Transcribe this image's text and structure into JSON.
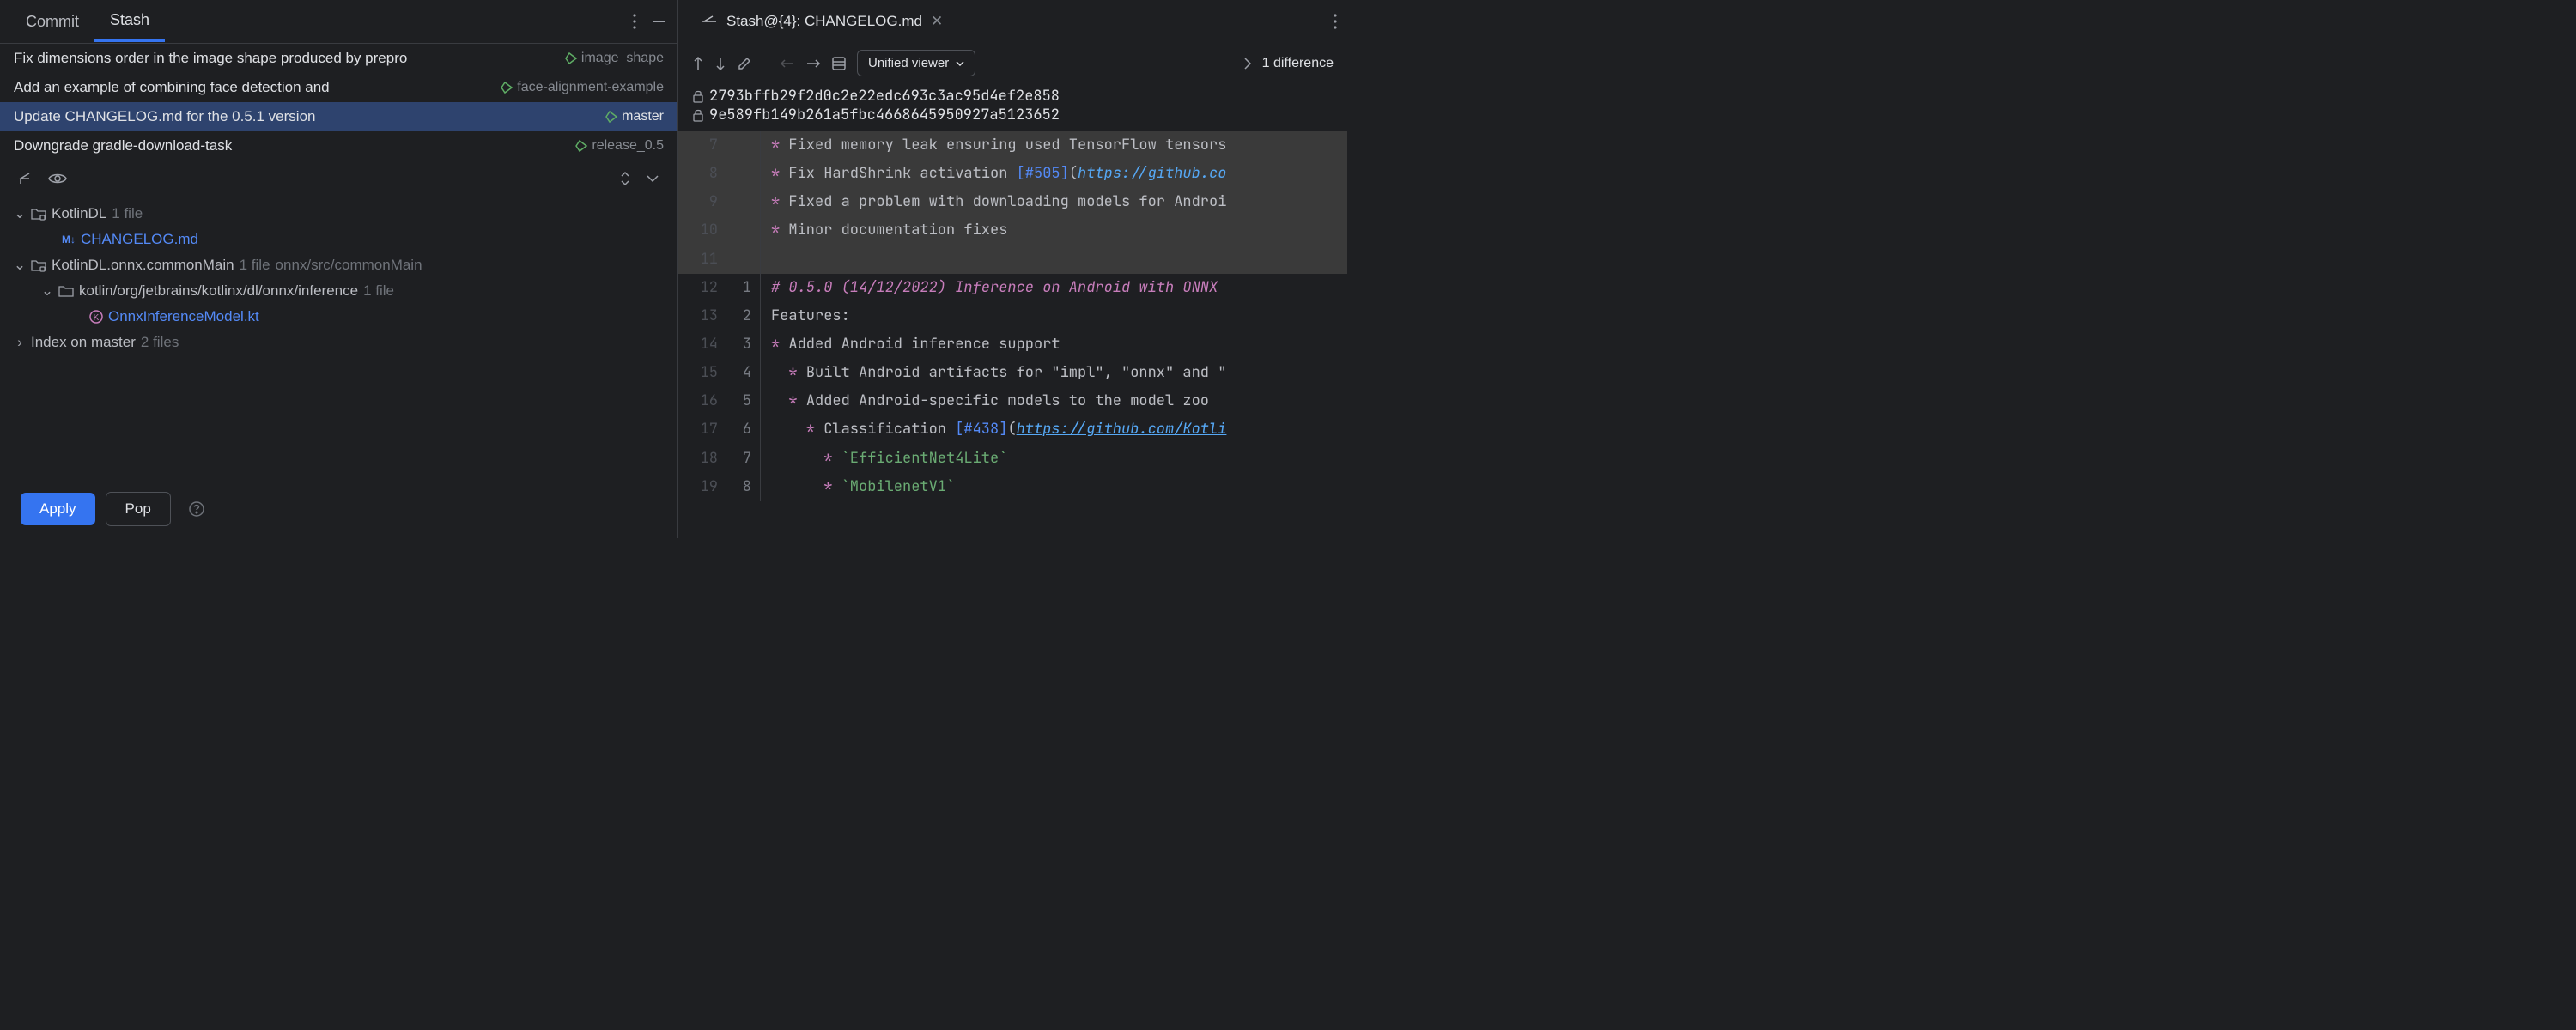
{
  "tabs": {
    "commit": "Commit",
    "stash": "Stash"
  },
  "commits": [
    {
      "msg": "Fix dimensions order in the image shape produced by prepro",
      "branch": "image_shape"
    },
    {
      "msg": "Add an example of combining face detection and ",
      "branch": "face-alignment-example"
    },
    {
      "msg": "Update CHANGELOG.md for the 0.5.1 version",
      "branch": "master"
    },
    {
      "msg": "Downgrade gradle-download-task",
      "branch": "release_0.5"
    }
  ],
  "tree": {
    "root1": {
      "name": "KotlinDL",
      "count": "1 file"
    },
    "file1": "CHANGELOG.md",
    "root2": {
      "name": "KotlinDL.onnx.commonMain",
      "count": "1 file",
      "path": "onnx/src/commonMain"
    },
    "sub2": {
      "name": "kotlin/org/jetbrains/kotlinx/dl/onnx/inference",
      "count": "1 file"
    },
    "file2": "OnnxInferenceModel.kt",
    "index": {
      "name": "Index on master",
      "count": "2 files"
    }
  },
  "buttons": {
    "apply": "Apply",
    "pop": "Pop"
  },
  "editorTab": "Stash@{4}: CHANGELOG.md",
  "viewer": "Unified viewer",
  "diffCount": "1 difference",
  "hashes": {
    "a": "2793bffb29f2d0c2e22edc693c3ac95d4ef2e858",
    "b": "9e589fb149b261a5fbc4668645950927a5123652"
  },
  "gutters": {
    "left": [
      "7",
      "8",
      "9",
      "10",
      "11",
      "12",
      "13",
      "14",
      "15",
      "16",
      "17",
      "18",
      "19"
    ],
    "right": [
      "",
      "",
      "",
      "",
      "",
      "1",
      "2",
      "3",
      "4",
      "5",
      "6",
      "7",
      "8"
    ]
  },
  "code": {
    "l7": {
      "star": "* ",
      "text": "Fixed memory leak ensuring used TensorFlow tensors"
    },
    "l8": {
      "star": "* ",
      "text": "Fix HardShrink activation ",
      "link": "[#505]",
      "url": "https://github.co"
    },
    "l9": {
      "star": "* ",
      "text": "Fixed a problem with downloading models for Androi"
    },
    "l10": {
      "star": "* ",
      "text": "Minor documentation fixes"
    },
    "l12": "# 0.5.0 (14/12/2022) Inference on Android with ONNX",
    "l13": "Features:",
    "l14": {
      "star": "* ",
      "text": "Added Android inference support"
    },
    "l15": {
      "star": "  * ",
      "text": "Built Android artifacts for \"impl\", \"onnx\" and \""
    },
    "l16": {
      "star": "  * ",
      "text": "Added Android-specific models to the model zoo"
    },
    "l17": {
      "star": "    * ",
      "text": "Classification ",
      "link": "[#438]",
      "url": "https://github.com/Kotli"
    },
    "l18": {
      "star": "      * ",
      "code": "`EfficientNet4Lite`"
    },
    "l19": {
      "star": "      * ",
      "code": "`MobilenetV1`"
    }
  }
}
